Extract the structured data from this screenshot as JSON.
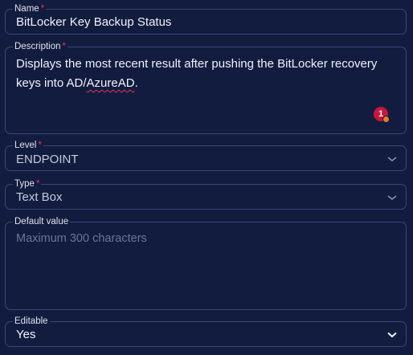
{
  "name_field": {
    "label": "Name",
    "required_mark": "*",
    "value": "BitLocker Key Backup Status"
  },
  "description_field": {
    "label": "Description",
    "required_mark": "*",
    "value_prefix": "Displays the most recent result after pushing the BitLocker recovery keys into AD/",
    "value_flagged": "AzureAD",
    "value_suffix": ".",
    "badge_count": "1"
  },
  "level_field": {
    "label": "Level",
    "required_mark": "*",
    "value": "ENDPOINT",
    "icon": "chevron-down-icon"
  },
  "type_field": {
    "label": "Type",
    "required_mark": "*",
    "value": "Text Box",
    "icon": "chevron-down-icon"
  },
  "default_value_field": {
    "label": "Default value",
    "placeholder": "Maximum 300 characters"
  },
  "editable_field": {
    "label": "Editable",
    "value": "Yes",
    "icon": "chevron-down-icon"
  },
  "colors": {
    "background": "#121c3f",
    "border": "#3b4874",
    "required": "#e0365a",
    "badge": "#c8173c",
    "badge_dot": "#e67e22"
  }
}
